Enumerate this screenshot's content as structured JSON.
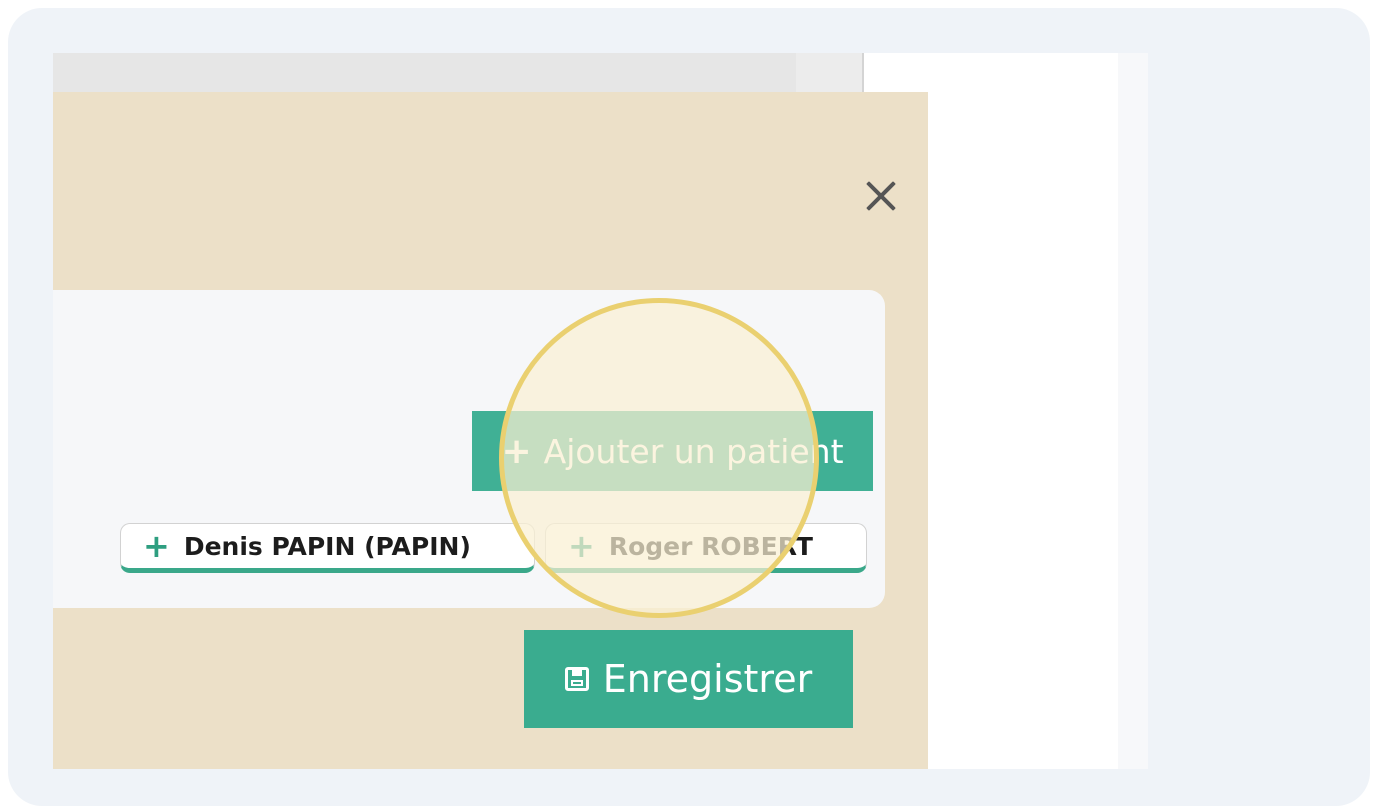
{
  "modal": {
    "close_label": "×",
    "add_patient_button": {
      "icon": "plus-icon",
      "label": "Ajouter un patient"
    },
    "patient_chips": [
      {
        "icon": "plus-icon",
        "label": "Denis PAPIN (PAPIN)"
      },
      {
        "icon": "plus-icon",
        "label": "Roger ROBERT"
      }
    ],
    "save_button": {
      "icon": "floppy-disk-icon",
      "label": "Enregistrer"
    }
  },
  "colors": {
    "modal_background": "#ece0c8",
    "accent_green": "#3aac8f",
    "highlight_ring": "#ead070"
  }
}
